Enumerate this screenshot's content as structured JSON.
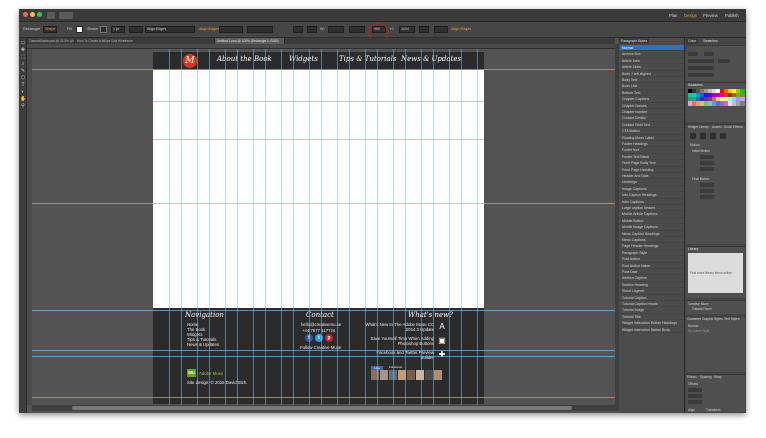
{
  "window": {
    "title": "Photoshop",
    "menubar": {
      "workspace_items": [
        "Plan",
        "Design",
        "Preview",
        "Publish"
      ],
      "active": "Design"
    }
  },
  "options": {
    "tool": "Rectangle",
    "shape_label": "Shape",
    "fill_label": "Fill",
    "stroke_label": "Stroke",
    "stroke_size": "1 pt",
    "width_label": "W:",
    "width_value": "960",
    "height_label": "H:",
    "height_value": "1024",
    "align_edges_label": "Align Edges"
  },
  "tabs": [
    {
      "label": "TutorialShade.psd @ 33.3% (Wordpress)",
      "active": false
    },
    {
      "label": "How To Create A 960px Grid Wireframe",
      "active": false
    },
    {
      "label": "Untitled-1.psd @ 100% (Rectangle 1, RGB)",
      "active": true
    }
  ],
  "tools": [
    "▭",
    "✥",
    "⬚",
    "⌕",
    "✎",
    "⬡",
    "T",
    "◐",
    "✋",
    "⚲"
  ],
  "site": {
    "logo_letter": "M",
    "nav": [
      "About the Book",
      "Widgets",
      "Tips & Tutorials",
      "News & Updates"
    ],
    "footer": {
      "navigation": {
        "heading": "Navigation",
        "links": [
          "Home",
          "The Book",
          "Widgets",
          "Tips & Tutorials",
          "News & Updates"
        ]
      },
      "contact": {
        "heading": "Contact",
        "email": "hello@creativemu.se",
        "phone": "+44 7877 117724",
        "follow": "Follow Creative Muse",
        "social": [
          "f",
          "t",
          "p"
        ]
      },
      "whats_new": {
        "heading": "What's new?",
        "posts": [
          "What's New In The Adobe Muse CC 2014.3 Update",
          "Save Yourself Time When Adding Photoshop Buttons",
          "Facebook and Twitter Preview Builder"
        ]
      },
      "badge": "Mu",
      "badge_caption": "Adobe Muse",
      "credit": "Site design: © 2015 David Bich.",
      "like_label": "Like",
      "friends_label": "Facebook"
    }
  },
  "panels": {
    "paragraph_styles": {
      "tabs": [
        "Paragraph Styles"
      ],
      "items": [
        "Normal",
        "Archive Box",
        "Article Intro",
        "Article Links",
        "Body + left aligned",
        "Body Text",
        "Book Link",
        "Bottom Text",
        "Chapter Captions",
        "Chapter Names",
        "Chapter number",
        "Contact Details",
        "Contact Field Text",
        "CTA Button",
        "Floating Menu Label",
        "Footer Headings",
        "Footer text",
        "Footer Text Black",
        "Front Page Body Text",
        "Front Page Heading",
        "Header and Date",
        "Headings",
        "Image Captions",
        "Info Caption Headings",
        "Intro Captions",
        "Large caption header",
        "Mobile Article Captions",
        "Mobile Button",
        "Mobile Image Captions",
        "News Caption Headings",
        "News Captions",
        "Page Header Headings",
        "Paragraph Style",
        "Post Author",
        "Post Author Name",
        "Post Date",
        "Section Caption",
        "Section Heading",
        "Shout Legend",
        "Tutorial Caption",
        "Tutorial Caption Heads",
        "Tutorial Image",
        "Tutorial Title",
        "Widget Instruction Button Headings",
        "Widget Instruction Button Body"
      ],
      "selected_index": 0
    },
    "dock": {
      "color_tabs": [
        "Color",
        "Swatches"
      ],
      "swatches_label": "Swatches",
      "properties_label": "Properties",
      "properties_tabs": [
        "Widget Library",
        "Assets",
        "Scroll Effects"
      ],
      "motion_label": "Motion",
      "initial_motion": "Initial Motion",
      "final_motion": "Final Motion",
      "library_label": "Library",
      "library_hint": "Find more library items online",
      "library_link": "online",
      "creative_muse": "Creative Muse",
      "tutorial_panel": "Tutorial Panel",
      "character_tabs": [
        "Character",
        "Graphic Styles",
        "Text Styles"
      ],
      "normal_label": "Normal",
      "no_active": "No Active Style",
      "effects_tabs": [
        "Effects",
        "Spacing",
        "Wrap"
      ],
      "offsets_label": "Offsets",
      "align_label": "Align",
      "transform_label": "Transform"
    },
    "swatch_colors": [
      "#000000",
      "#333333",
      "#555555",
      "#777777",
      "#999999",
      "#bbbbbb",
      "#dddddd",
      "#ffffff",
      "#ff0000",
      "#ff6600",
      "#ffcc00",
      "#ffff00",
      "#99cc00",
      "#00cc00",
      "#00cc99",
      "#00cccc",
      "#0099cc",
      "#0066ff",
      "#3300ff",
      "#6600cc",
      "#9900cc",
      "#cc0099",
      "#ff0066",
      "#cc3333",
      "#993300",
      "#996633",
      "#999933",
      "#669933",
      "#339966",
      "#339999",
      "#336699",
      "#333399",
      "#663399",
      "#993366",
      "#cc6666",
      "#ffcc99",
      "#ffff99",
      "#ccff99",
      "#99ffcc",
      "#99ccff",
      "#9999ff",
      "#cc99ff",
      "#ff99cc",
      "#ff6666",
      "#ff9966",
      "#cccc66",
      "#66cc66",
      "#66cccc",
      "#6699cc",
      "#6666cc",
      "#9966cc",
      "#cc66cc",
      "#e0e0e0",
      "#c0c0c0",
      "#a0a0a0",
      "#808080"
    ]
  },
  "colors": {
    "accent_red": "#d0181c",
    "logo_orange": "#d8391c",
    "guide_blue": "#78bdeb",
    "selection_blue": "#2e6fc4"
  }
}
